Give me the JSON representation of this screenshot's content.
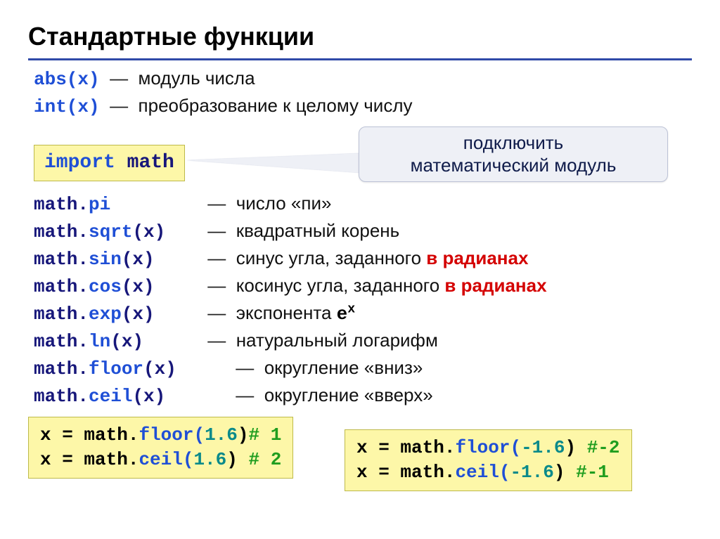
{
  "title": "Стандартные функции",
  "builtin": [
    {
      "fn": "abs(x)",
      "desc": "модуль числа"
    },
    {
      "fn": "int(x)",
      "desc": "преобразование к целому числу"
    }
  ],
  "import": {
    "kw": "import",
    "mod": "math"
  },
  "callout": {
    "line1": "подключить",
    "line2": "математический модуль"
  },
  "mathfns": [
    {
      "ns": "math.",
      "name": "pi",
      "args": "",
      "desc": "число «пи»",
      "radians": ""
    },
    {
      "ns": "math.",
      "name": "sqrt",
      "args": "(x)",
      "desc": "квадратный корень",
      "radians": ""
    },
    {
      "ns": "math.",
      "name": "sin",
      "args": "(x)",
      "desc": "синус угла, заданного ",
      "radians": "в радианах"
    },
    {
      "ns": "math.",
      "name": "cos",
      "args": "(x)",
      "desc": "косинус угла, заданного ",
      "radians": "в радианах"
    },
    {
      "ns": "math.",
      "name": "exp",
      "args": "(x)",
      "desc": "экспонента ",
      "sup_base": "e",
      "sup_exp": "x"
    },
    {
      "ns": "math.",
      "name": "ln",
      "args": "(x)",
      "desc": "натуральный логарифм",
      "radians": ""
    },
    {
      "ns": "math.",
      "name": "floor",
      "args": "(x)",
      "desc": "округление «вниз»",
      "radians": ""
    },
    {
      "ns": "math.",
      "name": "ceil",
      "args": "(x)",
      "desc": "округление «вверх»",
      "radians": ""
    }
  ],
  "dash": "—",
  "ex_left": {
    "l1_pre": "x = math.",
    "l1_fn": "floor(",
    "l1_lit": "1.6",
    "l1_post": ")",
    "l1_cmt": "# 1",
    "l2_pre": "x = math.",
    "l2_fn": "ceil(",
    "l2_lit": "1.6",
    "l2_post": ") ",
    "l2_cmt": "# 2"
  },
  "ex_right": {
    "l1_pre": "x = math.",
    "l1_fn": "floor(",
    "l1_lit": "-1.6",
    "l1_post": ") ",
    "l1_cmt": "#-2",
    "l2_pre": "x = math.",
    "l2_fn": "ceil(",
    "l2_lit": "-1.6",
    "l2_post": ")  ",
    "l2_cmt": "#-1"
  }
}
